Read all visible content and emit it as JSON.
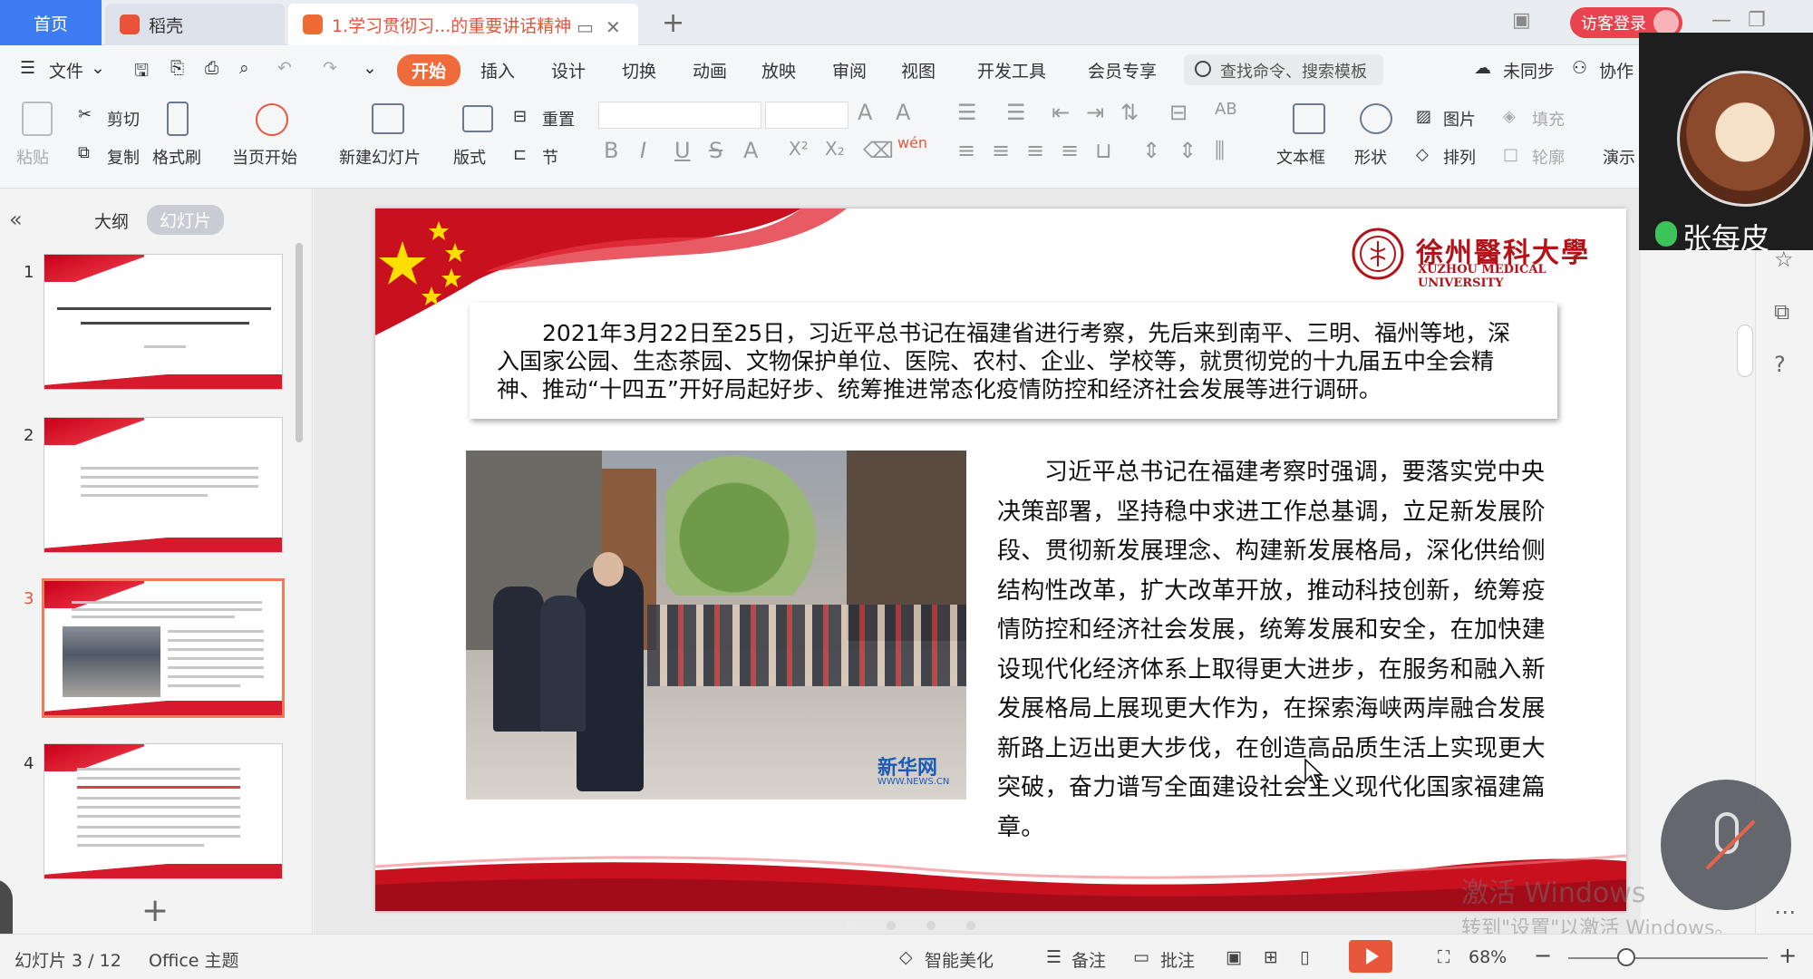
{
  "tabs": {
    "home": "首页",
    "docer": "稻壳",
    "doc": "1.学习贯彻习...的重要讲话精神",
    "new_tab": "+"
  },
  "header": {
    "login": "访客登录"
  },
  "menu": {
    "items": [
      "文件",
      "开始",
      "插入",
      "设计",
      "切换",
      "动画",
      "放映",
      "审阅",
      "视图",
      "开发工具",
      "会员专享"
    ],
    "active": "开始",
    "search_placeholder": "查找命令、搜索模板",
    "sync": "未同步",
    "collab": "协作"
  },
  "ribbon": {
    "paste": "粘贴",
    "cut": "剪切",
    "copy": "复制",
    "format_painter": "格式刷",
    "from_current": "当页开始",
    "new_slide": "新建幻灯片",
    "layout": "版式",
    "reset": "重置",
    "section": "节",
    "textbox": "文本框",
    "shape": "形状",
    "picture": "图片",
    "fill": "填充",
    "arrange": "排列",
    "outline": "轮廓",
    "present": "演示"
  },
  "pane": {
    "outline_tab": "大纲",
    "slides_tab": "幻灯片",
    "collapse": "«",
    "thumbs": [
      "1",
      "2",
      "3",
      "4"
    ],
    "add": "+"
  },
  "slide": {
    "logo_cn": "徐州醫科大學",
    "logo_en": "XUZHOU MEDICAL UNIVERSITY",
    "intro": "2021年3月22日至25日，习近平总书记在福建省进行考察，先后来到南平、三明、福州等地，深入国家公园、生态茶园、文物保护单位、医院、农村、企业、学校等，就贯彻党的十九届五中全会精神、推动“十四五”开好局起好步、统筹推进常态化疫情防控和经济社会发展等进行调研。",
    "body": "习近平总书记在福建考察时强调，要落实党中央决策部署，坚持稳中求进工作总基调，立足新发展阶段、贯彻新发展理念、构建新发展格局，深化供给侧结构性改革，扩大改革开放，推动科技创新，统筹疫情防控和经济社会发展，统筹发展和安全，在加快建设现代化经济体系上取得更大进步，在服务和融入新发展格局上展现更大作为，在探索海峡两岸融合发展新路上迈出更大步伐，在创造高品质生活上实现更大突破，奋力谱写全面建设社会主义现代化国家福建篇章。",
    "photo_watermark": "新华网",
    "photo_watermark_url": "WWW.NEWS.CN"
  },
  "call": {
    "name": "张每皮"
  },
  "watermark": {
    "line1": "激活 Windows",
    "line2": "转到\"设置\"以激活 Windows。"
  },
  "status": {
    "slide_info": "幻灯片 3 / 12",
    "theme": "Office 主题",
    "beautify": "智能美化",
    "notes": "备注",
    "comments": "批注",
    "zoom": "68%",
    "minus": "−",
    "plus": "+"
  }
}
